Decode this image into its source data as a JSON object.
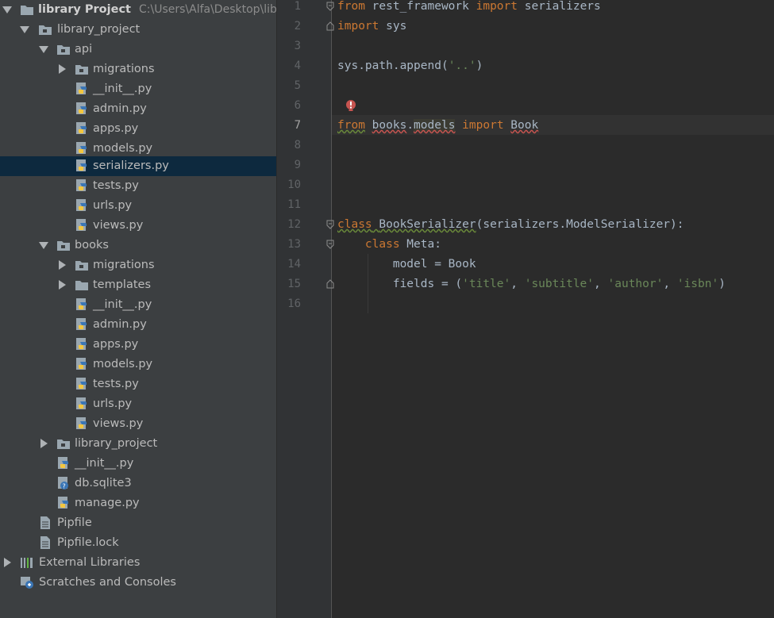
{
  "project_tree": {
    "project": {
      "name": "library Project",
      "path": "C:\\Users\\Alfa\\Desktop\\library"
    },
    "items": [
      {
        "label": "library_project"
      },
      {
        "label": "api"
      },
      {
        "label": "migrations"
      },
      {
        "label": "__init__.py"
      },
      {
        "label": "admin.py"
      },
      {
        "label": "apps.py"
      },
      {
        "label": "models.py"
      },
      {
        "label": "serializers.py"
      },
      {
        "label": "tests.py"
      },
      {
        "label": "urls.py"
      },
      {
        "label": "views.py"
      },
      {
        "label": "books"
      },
      {
        "label": "migrations"
      },
      {
        "label": "templates"
      },
      {
        "label": "__init__.py"
      },
      {
        "label": "admin.py"
      },
      {
        "label": "apps.py"
      },
      {
        "label": "models.py"
      },
      {
        "label": "tests.py"
      },
      {
        "label": "urls.py"
      },
      {
        "label": "views.py"
      },
      {
        "label": "library_project"
      },
      {
        "label": "__init__.py"
      },
      {
        "label": "db.sqlite3"
      },
      {
        "label": "manage.py"
      },
      {
        "label": "Pipfile"
      },
      {
        "label": "Pipfile.lock"
      },
      {
        "label": "External Libraries"
      },
      {
        "label": "Scratches and Consoles"
      }
    ]
  },
  "editor": {
    "line_numbers": [
      "1",
      "2",
      "3",
      "4",
      "5",
      "6",
      "7",
      "8",
      "9",
      "10",
      "11",
      "12",
      "13",
      "14",
      "15",
      "16"
    ],
    "code": {
      "l1": {
        "kw_from": "from",
        "module": " rest_framework ",
        "kw_import": "import",
        "name": " serializers"
      },
      "l2": {
        "kw_import": "import",
        "name": " sys"
      },
      "l4": {
        "text": "sys.path.append(",
        "str": "'..'",
        "close": ")"
      },
      "l7": {
        "kw_from": "from",
        "sp": " ",
        "pkg": "books",
        "dot": ".",
        "mod": "models",
        "sp2": " ",
        "kw_import": "import",
        "sp3": " ",
        "name": "Book"
      },
      "l12": {
        "kw_class": "class",
        "sp": " ",
        "name": "BookSerializer",
        "rest": "(serializers.ModelSerializer):"
      },
      "l13": {
        "indent": "    ",
        "kw_class": "class",
        "rest": " Meta:"
      },
      "l14": {
        "text": "        model = Book"
      },
      "l15": {
        "prefix": "        fields = (",
        "s1": "'title'",
        "c1": ", ",
        "s2": "'subtitle'",
        "c2": ", ",
        "s3": "'author'",
        "c3": ", ",
        "s4": "'isbn'",
        "close": ")"
      }
    }
  },
  "colors": {
    "tree_bg": "#3c3f41",
    "selected_row": "#0d293e",
    "editor_bg": "#2b2b2b",
    "keyword": "#cc7832",
    "string": "#6a8759",
    "text": "#a9b7c6",
    "error": "#c75450"
  },
  "icons": {
    "folder": "folder-icon",
    "python_file": "python-file-icon",
    "db_file": "database-file-icon",
    "text_file": "text-file-icon",
    "libraries": "libraries-icon",
    "scratches": "scratches-icon",
    "error_bulb": "error-bulb-icon"
  }
}
